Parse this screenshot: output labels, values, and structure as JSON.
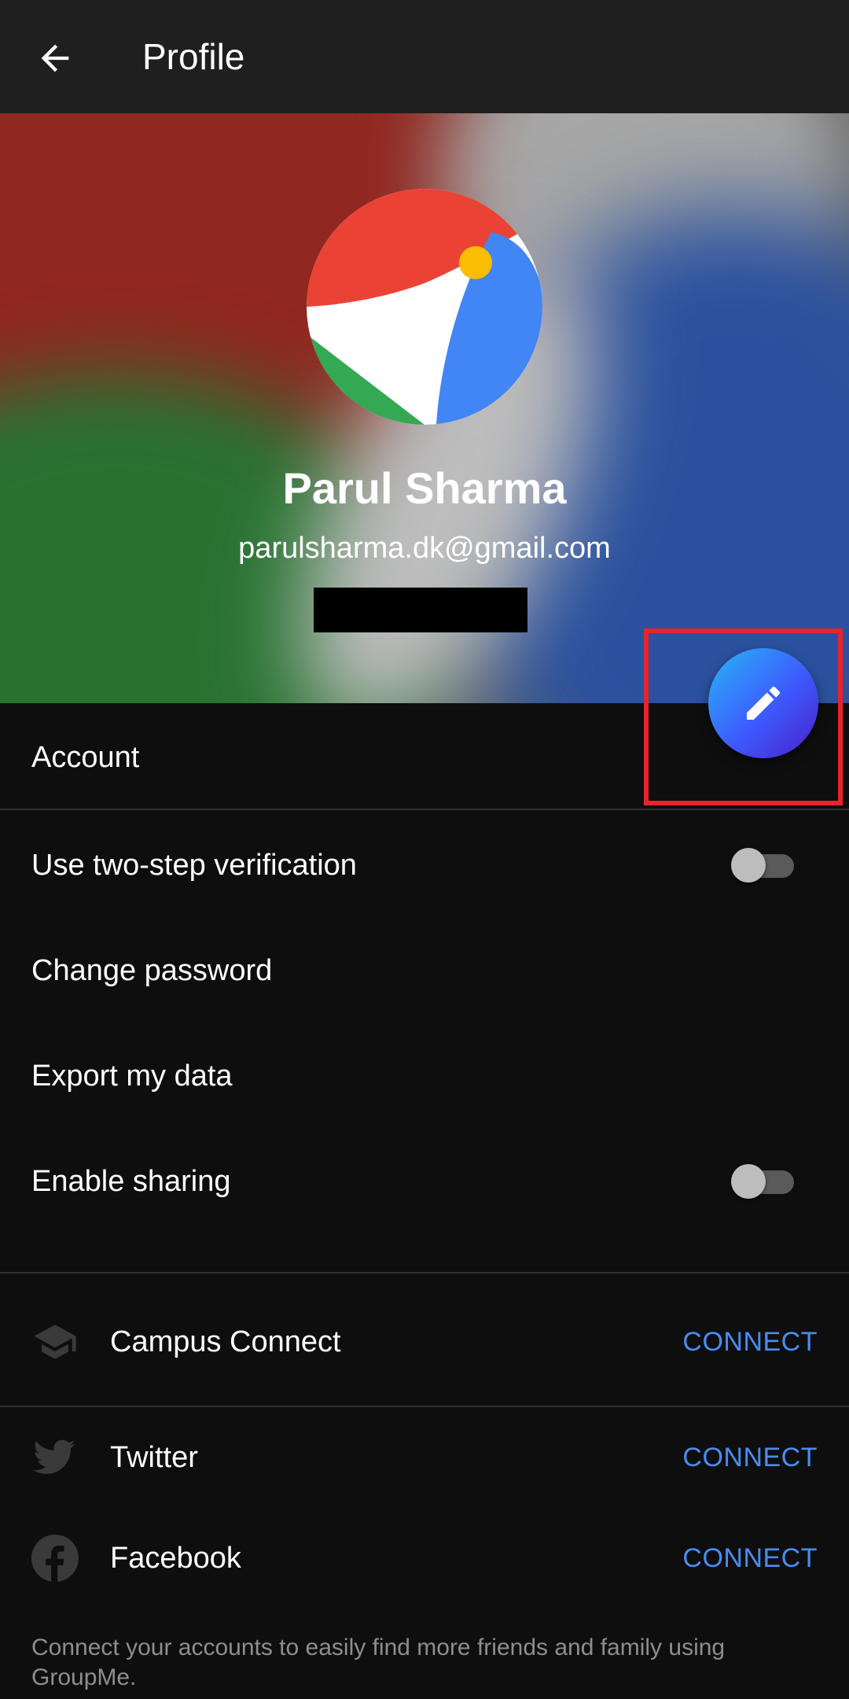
{
  "appbar": {
    "title": "Profile",
    "back_icon": "arrow-left-icon"
  },
  "profile": {
    "name": "Parul Sharma",
    "email": "parulsharma.dk@gmail.com",
    "avatar_icon": "profile-avatar"
  },
  "edit_button": {
    "icon": "pencil-icon",
    "highlighted": true,
    "highlight_color": "#e8232b"
  },
  "account": {
    "section_title": "Account",
    "items": [
      {
        "label": "Use two-step verification",
        "toggle": false
      },
      {
        "label": "Change password"
      },
      {
        "label": "Export my data"
      },
      {
        "label": "Enable sharing",
        "toggle": false
      }
    ]
  },
  "connections": {
    "items": [
      {
        "label": "Campus Connect",
        "icon": "graduation-cap-icon",
        "action": "CONNECT"
      },
      {
        "label": "Twitter",
        "icon": "twitter-icon",
        "action": "CONNECT"
      },
      {
        "label": "Facebook",
        "icon": "facebook-icon",
        "action": "CONNECT"
      }
    ],
    "footer_note": "Connect your accounts to easily find more friends and family using GroupMe."
  },
  "colors": {
    "appbar_bg": "#1f1f1f",
    "background": "#0e0e0e",
    "accent_link": "#4a8cf0",
    "fab_gradient_start": "#29b6f6",
    "fab_gradient_end": "#4a1fc8"
  }
}
